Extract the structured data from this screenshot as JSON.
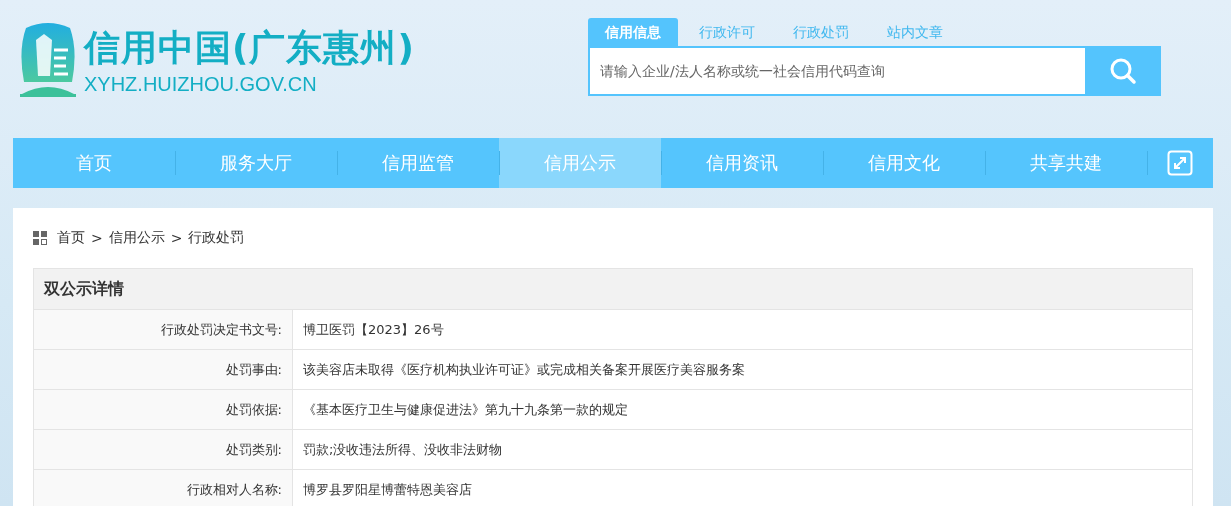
{
  "header": {
    "site_title": "信用中国(广东惠州)",
    "site_url": "XYHZ.HUIZHOU.GOV.CN"
  },
  "search": {
    "tabs": [
      {
        "label": "信用信息",
        "selected": true
      },
      {
        "label": "行政许可",
        "selected": false
      },
      {
        "label": "行政处罚",
        "selected": false
      },
      {
        "label": "站内文章",
        "selected": false
      }
    ],
    "placeholder": "请输入企业/法人名称或统一社会信用代码查询"
  },
  "nav": {
    "items": [
      {
        "label": "首页",
        "selected": false
      },
      {
        "label": "服务大厅",
        "selected": false
      },
      {
        "label": "信用监管",
        "selected": false
      },
      {
        "label": "信用公示",
        "selected": true
      },
      {
        "label": "信用资讯",
        "selected": false
      },
      {
        "label": "信用文化",
        "selected": false
      },
      {
        "label": "共享共建",
        "selected": false
      }
    ]
  },
  "breadcrumb": [
    "首页",
    "信用公示",
    "行政处罚"
  ],
  "breadcrumb_separator": ">",
  "details": {
    "title": "双公示详情",
    "rows": [
      {
        "label": "行政处罚决定书文号:",
        "value": "博卫医罚【2023】26号"
      },
      {
        "label": "处罚事由:",
        "value": "该美容店未取得《医疗机构执业许可证》或完成相关备案开展医疗美容服务案"
      },
      {
        "label": "处罚依据:",
        "value": "《基本医疗卫生与健康促进法》第九十九条第一款的规定"
      },
      {
        "label": "处罚类别:",
        "value": "罚款;没收违法所得、没收非法财物"
      },
      {
        "label": "行政相对人名称:",
        "value": "博罗县罗阳星博蕾特恩美容店"
      }
    ]
  }
}
